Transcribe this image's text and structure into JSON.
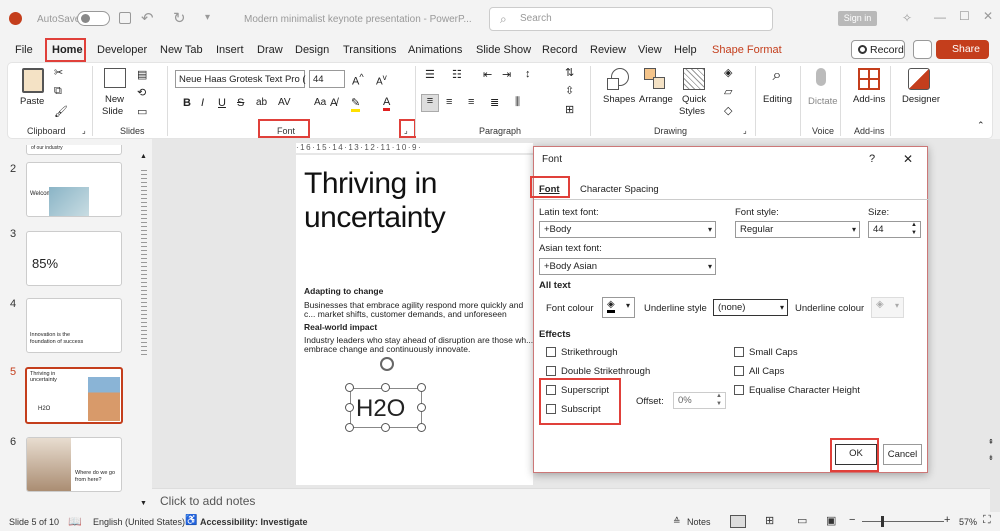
{
  "titlebar": {
    "autosave": "AutoSave",
    "doc_title": "Modern minimalist keynote presentation  -  PowerP...",
    "search_placeholder": "Search",
    "signin": "Sign in"
  },
  "menu": {
    "items": [
      "File",
      "Home",
      "Developer",
      "New Tab",
      "Insert",
      "Draw",
      "Design",
      "Transitions",
      "Animations",
      "Slide Show",
      "Record",
      "Review",
      "View",
      "Help",
      "Shape Format"
    ],
    "record_btn": "Record",
    "share_btn": "Share"
  },
  "ribbon": {
    "clipboard": {
      "paste": "Paste",
      "label": "Clipboard"
    },
    "slides": {
      "new_slide_1": "New",
      "new_slide_2": "Slide",
      "label": "Slides"
    },
    "font": {
      "font_name": "Neue Haas Grotesk Text Pro (",
      "font_size": "44",
      "label": "Font"
    },
    "paragraph": {
      "label": "Paragraph"
    },
    "drawing": {
      "shapes": "Shapes",
      "arrange": "Arrange",
      "quick_styles_1": "Quick",
      "quick_styles_2": "Styles",
      "label": "Drawing"
    },
    "editing": "Editing",
    "dictate": "Dictate",
    "voice_label": "Voice",
    "addins": "Add-ins",
    "addins_label": "Add-ins",
    "designer": "Designer"
  },
  "thumbnails": [
    {
      "num": "2",
      "text": "Welcome"
    },
    {
      "num": "3",
      "text": "85%"
    },
    {
      "num": "4",
      "text": "Innovation is the foundation of success"
    },
    {
      "num": "5",
      "title": "Thriving in uncertainty",
      "h2o": "H2O"
    },
    {
      "num": "6",
      "text": "Where do we go from here?"
    }
  ],
  "thumb_top_text": "of our industry",
  "ruler": "·16·15·14·13·12·11·10·9·",
  "slide": {
    "title": "Thriving in uncertainty",
    "h1": "Adapting to change",
    "p1": "Businesses that embrace agility respond more quickly and c... market shifts, customer demands, and unforeseen challenge...",
    "h2": "Real-world impact",
    "p2": "Industry leaders who stay ahead of disruption are those wh... embrace change and continuously innovate.",
    "h2o": "H2O"
  },
  "notes": "Click to add notes",
  "dialog": {
    "title": "Font",
    "help": "?",
    "close": "✕",
    "tab_font": "Font",
    "tab_spacing": "Character Spacing",
    "latin_label": "Latin text font:",
    "latin_value": "+Body",
    "style_label": "Font style:",
    "style_value": "Regular",
    "size_label": "Size:",
    "size_value": "44",
    "asian_label": "Asian text font:",
    "asian_value": "+Body Asian",
    "all_text": "All text",
    "font_colour": "Font colour",
    "underline_style": "Underline style",
    "underline_value": "(none)",
    "underline_colour": "Underline colour",
    "effects": "Effects",
    "strikethrough": "Strikethrough",
    "double_strikethrough": "Double Strikethrough",
    "superscript": "Superscript",
    "subscript": "Subscript",
    "offset_label": "Offset:",
    "offset_value": "0%",
    "small_caps": "Small Caps",
    "all_caps": "All Caps",
    "equalise": "Equalise Character Height",
    "ok": "OK",
    "cancel": "Cancel"
  },
  "status": {
    "slide": "Slide 5 of 10",
    "lang": "English (United States)",
    "access": "Accessibility: Investigate",
    "notes": "Notes",
    "zoom": "57%"
  },
  "colors": {
    "accent": "#c43e1c",
    "highlight_red": "#e0403a"
  }
}
